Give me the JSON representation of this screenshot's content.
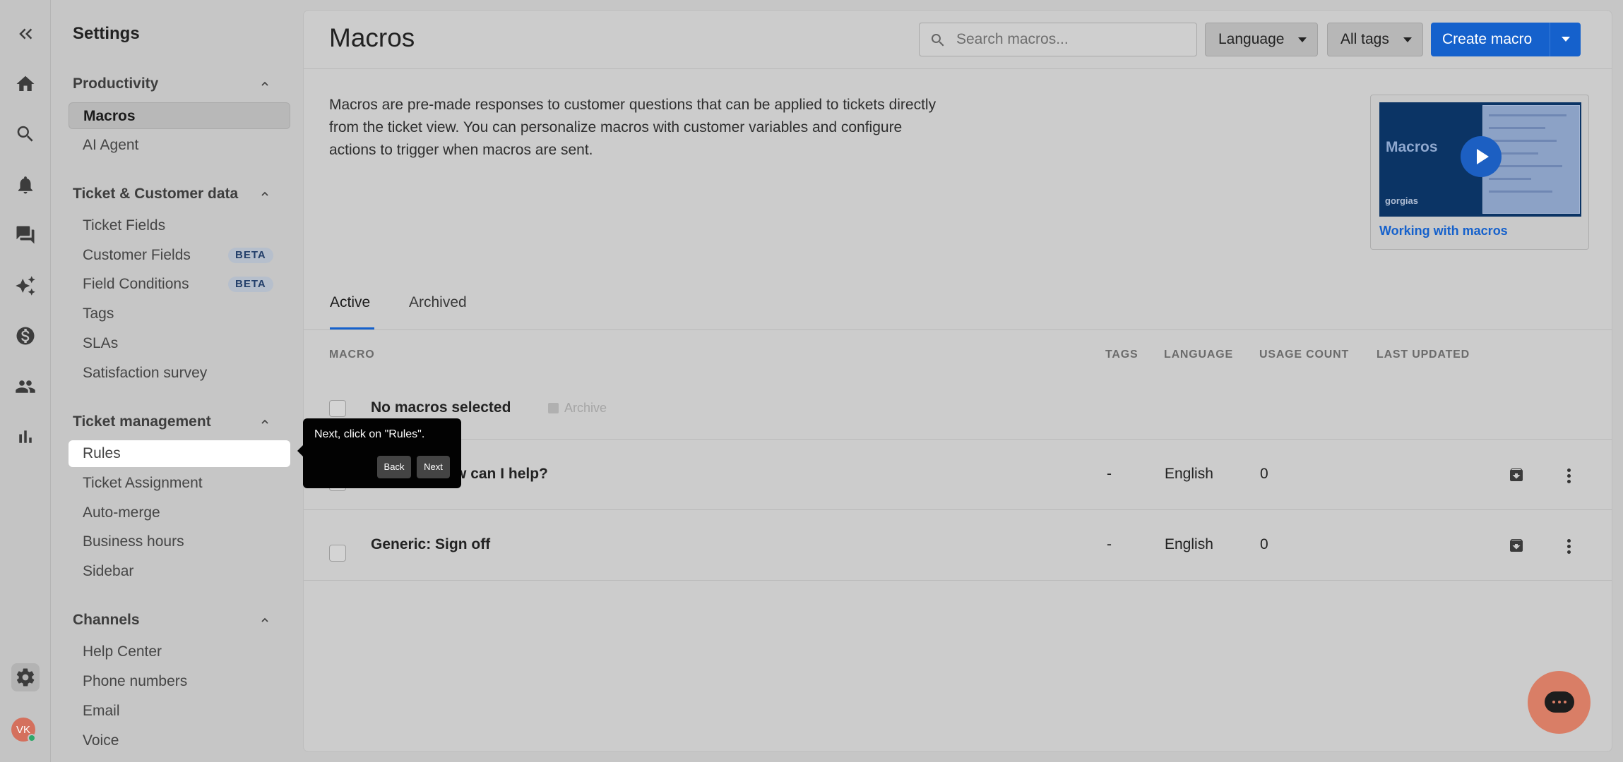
{
  "rail": {
    "items": [
      {
        "icon": "collapse-icon"
      },
      {
        "icon": "home-icon"
      },
      {
        "icon": "search-icon"
      },
      {
        "icon": "bell-icon"
      },
      {
        "icon": "chat-icon"
      },
      {
        "icon": "sparkles-icon"
      },
      {
        "icon": "dollar-icon"
      },
      {
        "icon": "users-icon"
      },
      {
        "icon": "bar-chart-icon"
      },
      {
        "icon": "gear-icon"
      }
    ],
    "avatar_initials": "VK"
  },
  "nav": {
    "title": "Settings",
    "sections": [
      {
        "title": "Productivity",
        "items": [
          {
            "label": "Macros",
            "selected": true
          },
          {
            "label": "AI Agent"
          }
        ]
      },
      {
        "title": "Ticket & Customer data",
        "items": [
          {
            "label": "Ticket Fields"
          },
          {
            "label": "Customer Fields",
            "badge": "BETA"
          },
          {
            "label": "Field Conditions",
            "badge": "BETA"
          },
          {
            "label": "Tags"
          },
          {
            "label": "SLAs"
          },
          {
            "label": "Satisfaction survey"
          }
        ]
      },
      {
        "title": "Ticket management",
        "items": [
          {
            "label": "Rules"
          },
          {
            "label": "Ticket Assignment"
          },
          {
            "label": "Auto-merge"
          },
          {
            "label": "Business hours"
          },
          {
            "label": "Sidebar"
          }
        ]
      },
      {
        "title": "Channels",
        "items": [
          {
            "label": "Help Center"
          },
          {
            "label": "Phone numbers"
          },
          {
            "label": "Email"
          },
          {
            "label": "Voice"
          }
        ]
      }
    ]
  },
  "header": {
    "title": "Macros",
    "search_placeholder": "Search macros...",
    "language_label": "Language",
    "tags_label": "All tags",
    "create_label": "Create macro"
  },
  "description": "Macros are pre-made responses to customer questions that can be applied to tickets directly from the ticket view. You can personalize macros with customer variables and configure actions to trigger when macros are sent.",
  "video": {
    "thumb_word": "Macros",
    "thumb_brand": "gorgias",
    "link": "Working with macros"
  },
  "tabs": [
    {
      "label": "Active"
    },
    {
      "label": "Archived"
    }
  ],
  "table": {
    "headers": [
      "MACRO",
      "TAGS",
      "LANGUAGE",
      "USAGE COUNT",
      "LAST UPDATED"
    ],
    "selection_text": "No macros selected",
    "archive_label": "Archive",
    "rows": [
      {
        "name": "General: How can I help?",
        "tags": "-",
        "language": "English",
        "usage": "0"
      },
      {
        "name": "Generic: Sign off",
        "tags": "-",
        "language": "English",
        "usage": "0"
      }
    ]
  },
  "tooltip": {
    "message": "Next, click on \"Rules\".",
    "back": "Back",
    "next": "Next"
  },
  "colors": {
    "accent": "#1561cc",
    "chat_bubble": "#d97e66"
  }
}
